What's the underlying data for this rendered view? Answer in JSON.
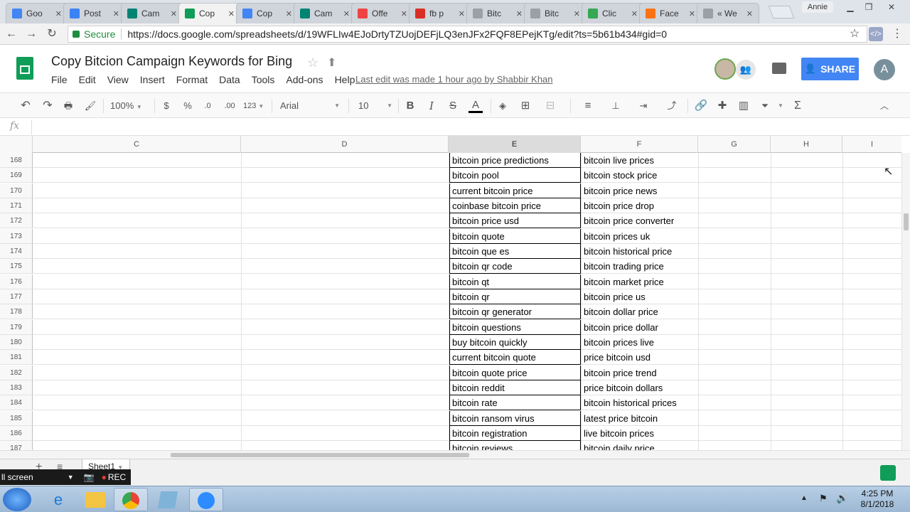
{
  "browser": {
    "tabs": [
      {
        "label": "Goo",
        "icon": "google-icon",
        "color": "#4285f4"
      },
      {
        "label": "Post",
        "icon": "circle-icon",
        "color": "#3b82f6"
      },
      {
        "label": "Cam",
        "icon": "bing-icon",
        "color": "#008373"
      },
      {
        "label": "Cop",
        "icon": "sheets-icon",
        "color": "#0f9d58"
      },
      {
        "label": "Cop",
        "icon": "docs-icon",
        "color": "#4285f4"
      },
      {
        "label": "Cam",
        "icon": "bing-icon",
        "color": "#008373"
      },
      {
        "label": "Offe",
        "icon": "offer-icon",
        "color": "#ef4444"
      },
      {
        "label": "fb p",
        "icon": "gmail-icon",
        "color": "#d93025"
      },
      {
        "label": "Bitc",
        "icon": "page-icon",
        "color": "#9aa0a6"
      },
      {
        "label": "Bitc",
        "icon": "page-icon",
        "color": "#9aa0a6"
      },
      {
        "label": "Clic",
        "icon": "clickmagick-icon",
        "color": "#34a853"
      },
      {
        "label": "Face",
        "icon": "analytics-icon",
        "color": "#f97316"
      },
      {
        "label": "« We",
        "icon": "page-icon",
        "color": "#9aa0a6"
      }
    ],
    "active_tab_index": 3,
    "profile_name": "Annie",
    "secure_label": "Secure",
    "url": "https://docs.google.com/spreadsheets/d/19WFLIw4EJoDrtyTZUojDEFjLQ3enJFx2FQF8EPejKTg/edit?ts=5b61b434#gid=0"
  },
  "doc": {
    "title": "Copy Bitcion Campaign Keywords for Bing",
    "menus": [
      "File",
      "Edit",
      "View",
      "Insert",
      "Format",
      "Data",
      "Tools",
      "Add-ons",
      "Help"
    ],
    "last_edit": "Last edit was made 1 hour ago by Shabbir Khan",
    "share_label": "SHARE",
    "account_initial": "A"
  },
  "toolbar": {
    "zoom": "100%",
    "currency": "$",
    "percent": "%",
    "decimal_decrease": ".0",
    "decimal_increase": ".00",
    "format_more": "123",
    "font": "Arial",
    "font_size": "10",
    "bold": "B",
    "italic": "I",
    "strike": "S",
    "text_color": "A",
    "sum": "Σ"
  },
  "formula_bar": {
    "fx": "fx",
    "value": ""
  },
  "grid": {
    "columns": [
      "C",
      "D",
      "E",
      "F",
      "G",
      "H",
      "I"
    ],
    "selected_column": "E",
    "rows": [
      {
        "num": "168",
        "e": "bitcoin price predictions",
        "f": "bitcoin live prices"
      },
      {
        "num": "169",
        "e": "bitcoin pool",
        "f": "bitcoin stock price"
      },
      {
        "num": "170",
        "e": "current bitcoin price",
        "f": "bitcoin price news"
      },
      {
        "num": "171",
        "e": "coinbase bitcoin price",
        "f": "bitcoin price drop"
      },
      {
        "num": "172",
        "e": "bitcoin price usd",
        "f": "bitcoin price converter"
      },
      {
        "num": "173",
        "e": "bitcoin quote",
        "f": "bitcoin prices uk"
      },
      {
        "num": "174",
        "e": "bitcoin que es",
        "f": "bitcoin historical price"
      },
      {
        "num": "175",
        "e": "bitcoin qr code",
        "f": "bitcoin trading price"
      },
      {
        "num": "176",
        "e": "bitcoin qt",
        "f": "bitcoin market price"
      },
      {
        "num": "177",
        "e": "bitcoin qr",
        "f": "bitcoin price us"
      },
      {
        "num": "178",
        "e": "bitcoin qr generator",
        "f": "bitcoin dollar price"
      },
      {
        "num": "179",
        "e": "bitcoin questions",
        "f": "bitcoin price dollar"
      },
      {
        "num": "180",
        "e": "buy bitcoin quickly",
        "f": "bitcoin prices live"
      },
      {
        "num": "181",
        "e": "current bitcoin quote",
        "f": "price bitcoin usd"
      },
      {
        "num": "182",
        "e": "bitcoin quote price",
        "f": "bitcoin price trend"
      },
      {
        "num": "183",
        "e": "bitcoin reddit",
        "f": "price bitcoin dollars"
      },
      {
        "num": "184",
        "e": "bitcoin rate",
        "f": "bitcoin historical prices"
      },
      {
        "num": "185",
        "e": "bitcoin ransom virus",
        "f": "latest price bitcoin"
      },
      {
        "num": "186",
        "e": "bitcoin registration",
        "f": "live bitcoin prices"
      },
      {
        "num": "187",
        "e": "bitcoin reviews",
        "f": "bitcoin daily price"
      }
    ]
  },
  "sheets": {
    "active": "Sheet1"
  },
  "recorder": {
    "label": "ll screen",
    "rec": "REC"
  },
  "taskbar": {
    "time": "4:25 PM",
    "date": "8/1/2018"
  }
}
